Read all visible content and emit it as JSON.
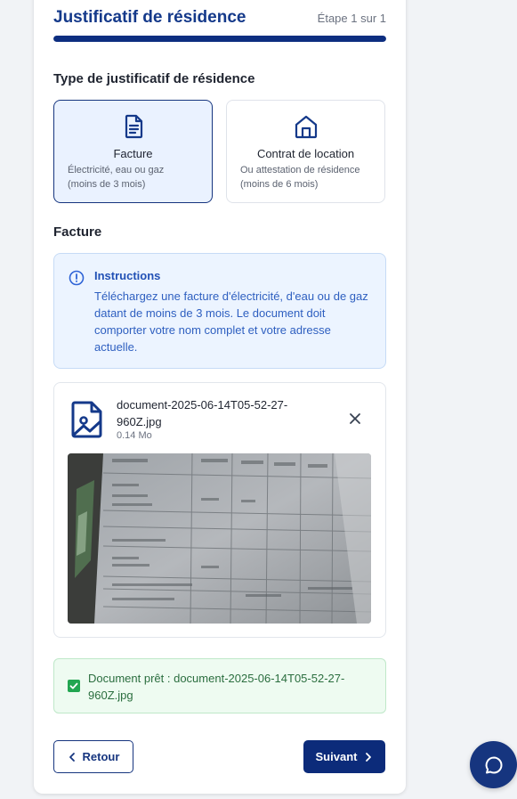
{
  "header": {
    "title": "Justificatif de résidence",
    "step": "Étape 1 sur 1",
    "progress_fraction": 1.0
  },
  "type_section": {
    "label": "Type de justificatif de résidence",
    "options": [
      {
        "icon": "document-icon",
        "name": "Facture",
        "desc1": "Électricité, eau ou gaz",
        "desc2": "(moins de 3 mois)",
        "selected": true
      },
      {
        "icon": "house-icon",
        "name": "Contrat de location",
        "desc1": "Ou attestation de résidence",
        "desc2": "(moins de 6 mois)",
        "selected": false
      }
    ]
  },
  "doc_section": {
    "label": "Facture",
    "instructions_title": "Instructions",
    "instructions_text": "Téléchargez une facture d'électricité, d'eau ou de gaz datant de moins de 3 mois. Le document doit comporter votre nom complet et votre adresse actuelle."
  },
  "file": {
    "name": "document-2025-06-14T05-52-27-960Z.jpg",
    "size": "0.14 Mo",
    "icon": "image-file-icon"
  },
  "ready": {
    "text": "Document prêt : document-2025-06-14T05-52-27-960Z.jpg"
  },
  "nav": {
    "back_label": "Retour",
    "next_label": "Suivant"
  },
  "colors": {
    "primary": "#0c2b7a",
    "title": "#14398a",
    "selected_bg": "#eaf2ff",
    "info_bg": "#ecf4ff",
    "success_bg": "#eefbf1",
    "success": "#22a651"
  }
}
